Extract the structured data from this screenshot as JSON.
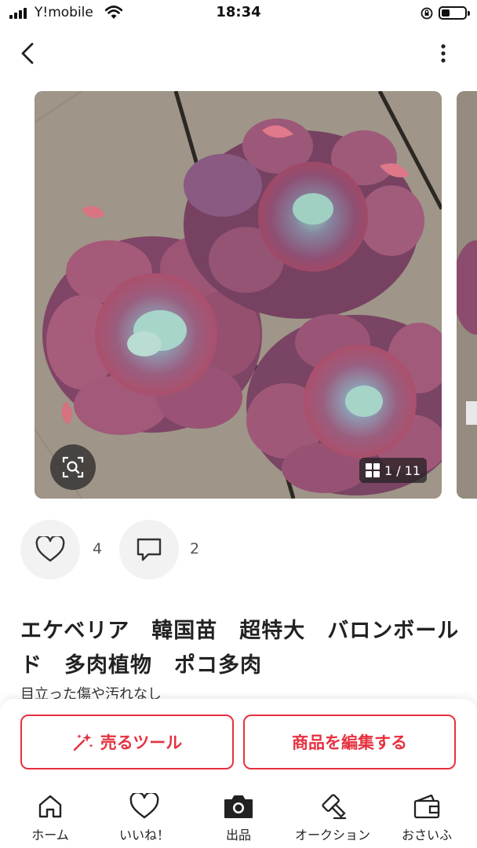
{
  "status_bar": {
    "carrier": "Y!mobile",
    "time": "18:34"
  },
  "gallery": {
    "counter": "1 / 11",
    "current_index": 1,
    "total": 11
  },
  "engagement": {
    "like_count": "4",
    "comment_count": "2"
  },
  "item": {
    "title": "エケベリア　韓国苗　超特大　バロンボールド　多肉植物　ポコ多肉",
    "condition": "目立った傷や汚れなし"
  },
  "actions": {
    "sell_tool_label": "売るツール",
    "edit_item_label": "商品を編集する"
  },
  "tabs": [
    {
      "label": "ホーム",
      "icon": "home-icon"
    },
    {
      "label": "いいね！",
      "icon": "heart-icon"
    },
    {
      "label": "出品",
      "icon": "camera-icon"
    },
    {
      "label": "オークション",
      "icon": "auction-hammer-icon"
    },
    {
      "label": "おさいふ",
      "icon": "wallet-icon"
    }
  ],
  "colors": {
    "accent": "#e6313f",
    "text": "#222222",
    "muted_bg": "#f2f2f2"
  }
}
